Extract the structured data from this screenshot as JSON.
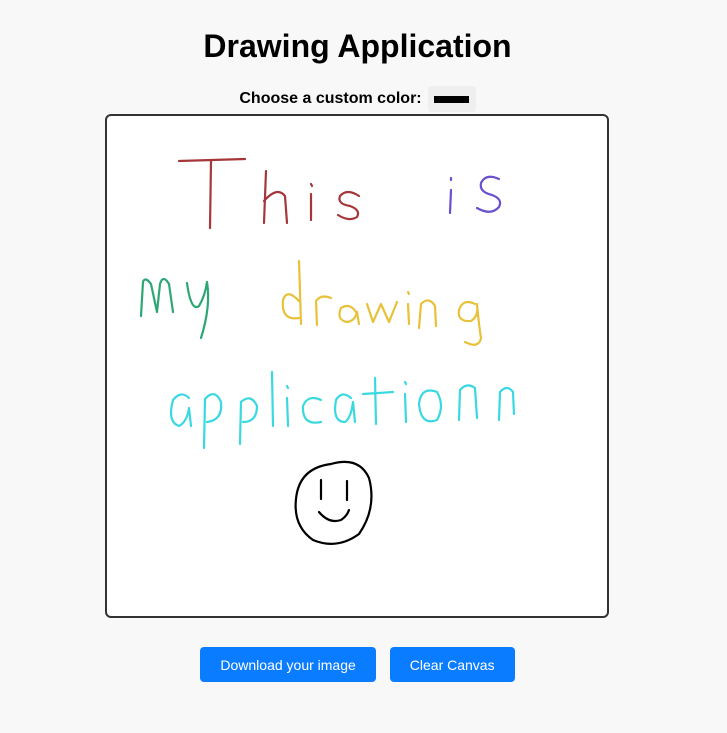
{
  "header": {
    "title": "Drawing Application"
  },
  "color_picker": {
    "label": "Choose a custom color:",
    "value": "#000000"
  },
  "canvas": {
    "background": "#ffffff",
    "strokes": [
      {
        "text": "This",
        "color": "#a5373a"
      },
      {
        "text": "is",
        "color": "#6a4fcf"
      },
      {
        "text": "my",
        "color": "#2ea774"
      },
      {
        "text": "drawing",
        "color": "#e8c13a"
      },
      {
        "text": "application",
        "color": "#3ad8e0"
      },
      {
        "shape": "smiley-face",
        "color": "#000000"
      }
    ]
  },
  "actions": {
    "download_label": "Download your image",
    "clear_label": "Clear Canvas",
    "accent": "#0a7cff"
  }
}
